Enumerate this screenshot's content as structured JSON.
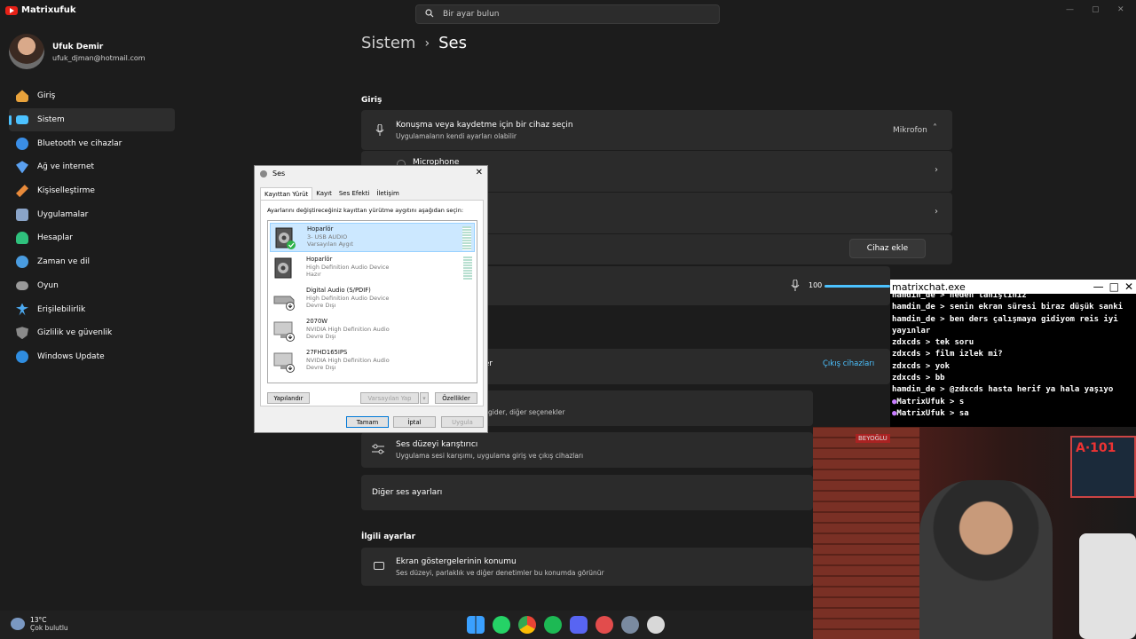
{
  "overlay": {
    "channel": "Matrixufuk"
  },
  "search": {
    "placeholder": "Bir ayar bulun"
  },
  "profile": {
    "name": "Ufuk Demir",
    "email": "ufuk_djman@hotmail.com"
  },
  "sidebar": {
    "items": [
      {
        "label": "Giriş",
        "icon": "home-icon",
        "color": "#e8a23b"
      },
      {
        "label": "Sistem",
        "icon": "monitor-icon",
        "color": "#4cc2ff",
        "active": true
      },
      {
        "label": "Bluetooth ve cihazlar",
        "icon": "bluetooth-icon",
        "color": "#3a8ee6"
      },
      {
        "label": "Ağ ve internet",
        "icon": "wifi-icon",
        "color": "#5aa0f0"
      },
      {
        "label": "Kişiselleştirme",
        "icon": "brush-icon",
        "color": "#e88a3a"
      },
      {
        "label": "Uygulamalar",
        "icon": "apps-icon",
        "color": "#8aa4c8"
      },
      {
        "label": "Hesaplar",
        "icon": "person-icon",
        "color": "#2fc17d"
      },
      {
        "label": "Zaman ve dil",
        "icon": "globe-clock-icon",
        "color": "#4a9ce0"
      },
      {
        "label": "Oyun",
        "icon": "gamepad-icon",
        "color": "#9a9a9a"
      },
      {
        "label": "Erişilebilirlik",
        "icon": "accessibility-icon",
        "color": "#4ca9f0"
      },
      {
        "label": "Gizlilik ve güvenlik",
        "icon": "shield-icon",
        "color": "#8a8a8a"
      },
      {
        "label": "Windows Update",
        "icon": "update-icon",
        "color": "#2f8de0"
      }
    ]
  },
  "main": {
    "breadcrumb_parent": "Sistem",
    "breadcrumb_current": "Ses",
    "input_section": "Giriş",
    "input_card_title": "Konuşma veya kaydetme için bir cihaz seçin",
    "input_card_sub": "Uygulamaların kendi ayarları olabilir",
    "input_card_value": "Mikrofon",
    "microphone_option": "Microphone",
    "add_device": "Cihaz ekle",
    "volume": "100",
    "output_devices_link": "Çıkış cihazları",
    "partial_ender": "der",
    "partial_more": "gider, diğer seçenekler",
    "mixer_title": "Ses düzeyi karıştırıcı",
    "mixer_sub": "Uygulama sesi karışımı, uygulama giriş ve çıkış cihazları",
    "more_sound": "Diğer ses ayarları",
    "related_section": "İlgili ayarlar",
    "overlay_title": "Ekran göstergelerinin konumu",
    "overlay_sub": "Ses düzeyi, parlaklık ve diğer denetimler bu konumda görünür",
    "bottom_partial": "İlgili..."
  },
  "dialog": {
    "title": "Ses",
    "tabs": [
      "Kayıttan Yürüt",
      "Kayıt",
      "Ses Efekti",
      "İletişim"
    ],
    "instruction": "Ayarlarını değiştireceğiniz kayıttan yürütme aygıtını aşağıdan seçin:",
    "devices": [
      {
        "name": "Hoparlör",
        "desc": "3- USB AUDIO",
        "status": "Varsayılan Aygıt",
        "icon": "speaker-icon",
        "selected": true
      },
      {
        "name": "Hoparlör",
        "desc": "High Definition Audio Device",
        "status": "Hazır",
        "icon": "speaker-icon"
      },
      {
        "name": "Digital Audio (S/PDIF)",
        "desc": "High Definition Audio Device",
        "status": "Devre Dışı",
        "icon": "spdif-icon"
      },
      {
        "name": "2070W",
        "desc": "NVIDIA High Definition Audio",
        "status": "Devre Dışı",
        "icon": "monitor-device-icon"
      },
      {
        "name": "27FHD165IPS",
        "desc": "NVIDIA High Definition Audio",
        "status": "Devre Dışı",
        "icon": "monitor-device-icon"
      }
    ],
    "configure": "Yapılandır",
    "set_default": "Varsayılan Yap",
    "properties": "Özellikler",
    "ok": "Tamam",
    "cancel": "İptal",
    "apply": "Uygula"
  },
  "chat": {
    "title": "matrixchat.exe",
    "lines": [
      "hamdin_de > neden tanıştınız",
      "hamdin_de > senin ekran süresi biraz düşük sanki",
      "hamdin_de > ben ders çalışmaya gidiyom reis iyi yayınlar",
      "zdxcds > tek soru",
      "zdxcds > film izlek mi?",
      "zdxcds > yok",
      "zdxcds > bb",
      "hamdin_de > @zdxcds hasta herif ya hala yaşıyo",
      "MatrixUfuk > s",
      "MatrixUfuk > sa"
    ]
  },
  "cam": {
    "sign_text": "A·101",
    "wall_text": "BEYOĞLU"
  },
  "taskbar": {
    "temp": "13°C",
    "weather": "Çok bulutlu",
    "icons": [
      "windows-start-icon",
      "whatsapp-icon",
      "chrome-icon",
      "spotify-icon",
      "discord-icon",
      "git-icon",
      "settings-icon",
      "sound-app-icon"
    ]
  }
}
